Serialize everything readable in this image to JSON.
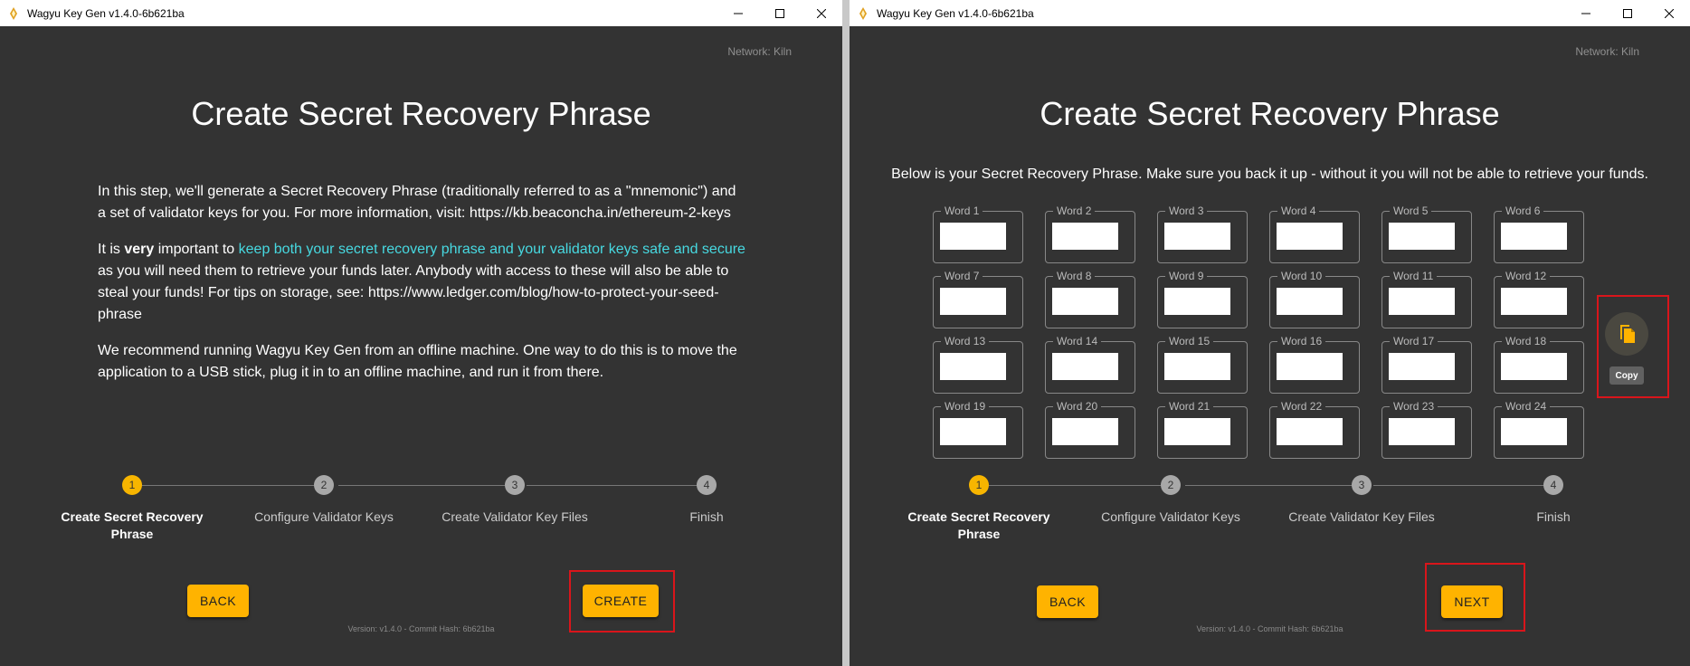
{
  "left": {
    "title": "Wagyu Key Gen v1.4.0-6b621ba",
    "network": "Network: Kiln",
    "heading": "Create Secret Recovery Phrase",
    "paragraph1": "In this step, we'll generate a Secret Recovery Phrase (traditionally referred to as a \"mnemonic\") and a set of validator keys for you. For more information, visit: https://kb.beaconcha.in/ethereum-2-keys",
    "paragraph2_pre": "It is ",
    "paragraph2_bold": "very",
    "paragraph2_mid": " important to ",
    "paragraph2_link": "keep both your secret recovery phrase and your validator keys safe and secure",
    "paragraph2_post": " as you will need them to retrieve your funds later. Anybody with access to these will also be able to steal your funds! For tips on storage, see: https://www.ledger.com/blog/how-to-protect-your-seed-phrase",
    "paragraph3": "We recommend running Wagyu Key Gen from an offline machine. One way to do this is to move the application to a USB stick, plug it in to an offline machine, and run it from there.",
    "steps": [
      {
        "number": "1",
        "label": "Create Secret Recovery Phrase"
      },
      {
        "number": "2",
        "label": "Configure Validator Keys"
      },
      {
        "number": "3",
        "label": "Create Validator Key Files"
      },
      {
        "number": "4",
        "label": "Finish"
      }
    ],
    "back_label": "BACK",
    "create_label": "CREATE",
    "version": "Version: v1.4.0 - Commit Hash: 6b621ba"
  },
  "right": {
    "title": "Wagyu Key Gen v1.4.0-6b621ba",
    "network": "Network: Kiln",
    "heading": "Create Secret Recovery Phrase",
    "description": "Below is your Secret Recovery Phrase. Make sure you back it up - without it you will not be able to retrieve your funds.",
    "words": [
      "Word 1",
      "Word 2",
      "Word 3",
      "Word 4",
      "Word 5",
      "Word 6",
      "Word 7",
      "Word 8",
      "Word 9",
      "Word 10",
      "Word 11",
      "Word 12",
      "Word 13",
      "Word 14",
      "Word 15",
      "Word 16",
      "Word 17",
      "Word 18",
      "Word 19",
      "Word 20",
      "Word 21",
      "Word 22",
      "Word 23",
      "Word 24"
    ],
    "copy_tooltip": "Copy",
    "steps": [
      {
        "number": "1",
        "label": "Create Secret Recovery Phrase"
      },
      {
        "number": "2",
        "label": "Configure Validator Keys"
      },
      {
        "number": "3",
        "label": "Create Validator Key Files"
      },
      {
        "number": "4",
        "label": "Finish"
      }
    ],
    "back_label": "BACK",
    "next_label": "NEXT",
    "version": "Version: v1.4.0 - Commit Hash: 6b621ba"
  },
  "colors": {
    "background": "#333333",
    "accent": "#ffb300",
    "link": "#47d9e1",
    "highlight": "#d9151b"
  }
}
